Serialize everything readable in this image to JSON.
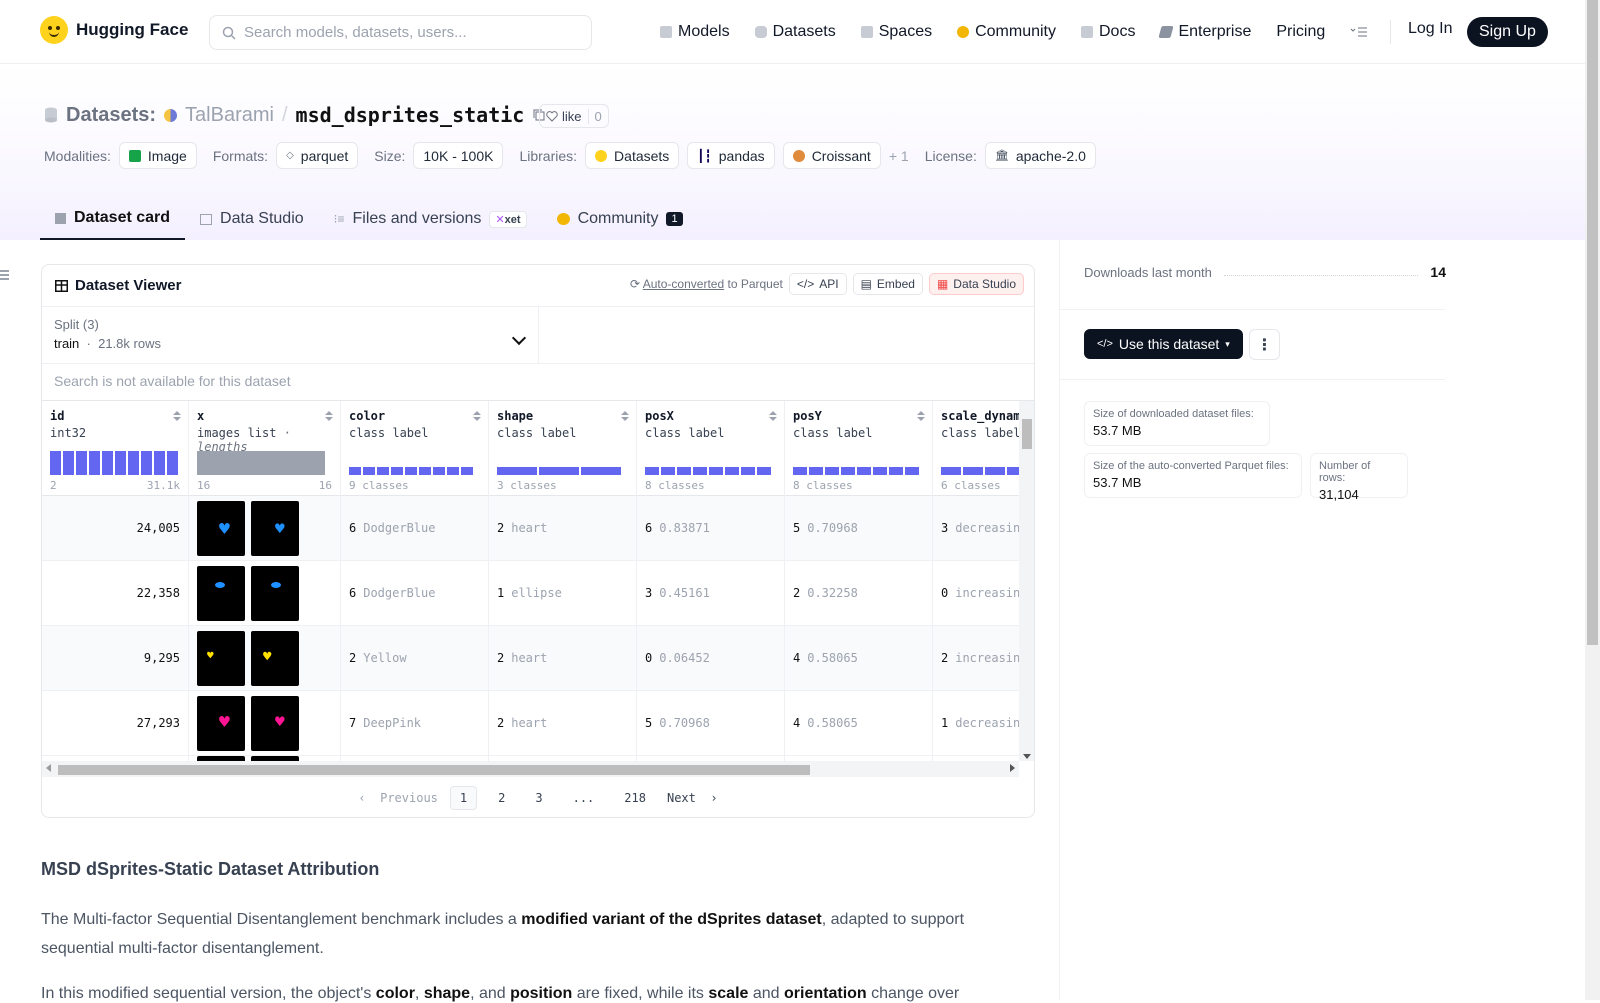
{
  "nav": {
    "brand": "Hugging Face",
    "search_placeholder": "Search models, datasets, users...",
    "items": [
      {
        "label": "Models",
        "icon": "cube-icon",
        "color": "#9ca3af"
      },
      {
        "label": "Datasets",
        "icon": "database-icon",
        "color": "#9ca3af"
      },
      {
        "label": "Spaces",
        "icon": "grid-icon",
        "color": "#9ca3af"
      },
      {
        "label": "Community",
        "icon": "hugging-icon",
        "color": "#f2b705"
      },
      {
        "label": "Docs",
        "icon": "book-icon",
        "color": "#9ca3af"
      },
      {
        "label": "Enterprise",
        "icon": "enterprise-icon",
        "color": "#6b7280"
      },
      {
        "label": "Pricing",
        "icon": "",
        "color": ""
      }
    ],
    "login": "Log In",
    "signup": "Sign Up"
  },
  "header": {
    "section": "Datasets:",
    "user": "TalBarami",
    "repo": "msd_dsprites_static",
    "like_label": "like",
    "like_count": "0",
    "modalities_k": "Modalities:",
    "modality": "Image",
    "formats_k": "Formats:",
    "format": "parquet",
    "size_k": "Size:",
    "size": "10K - 100K",
    "libraries_k": "Libraries:",
    "libraries": [
      "Datasets",
      "pandas",
      "Croissant"
    ],
    "lib_more": "+ 1",
    "license_k": "License:",
    "license": "apache-2.0"
  },
  "tabs": [
    {
      "label": "Dataset card",
      "active": true
    },
    {
      "label": "Data Studio"
    },
    {
      "label": "Files and versions",
      "badge": "xet"
    },
    {
      "label": "Community",
      "badge": "1"
    }
  ],
  "viewer": {
    "title": "Dataset Viewer",
    "autoconv": "Auto-converted",
    "autoconv_suffix": "to Parquet",
    "api": "API",
    "embed": "Embed",
    "studio": "Data Studio",
    "split_label": "Split (3)",
    "split_value": "train",
    "split_rows": "21.8k rows",
    "search_note": "Search is not available for this dataset",
    "columns": [
      {
        "name": "id",
        "type": "int32",
        "range_min": "2",
        "range_max": "31.1k"
      },
      {
        "name": "x",
        "type": "images list",
        "type_extra": "· lengths",
        "range_min": "16",
        "range_max": "16"
      },
      {
        "name": "color",
        "type": "class label",
        "classes": "9 classes"
      },
      {
        "name": "shape",
        "type": "class label",
        "classes": "3 classes"
      },
      {
        "name": "posX",
        "type": "class label",
        "classes": "8 classes"
      },
      {
        "name": "posY",
        "type": "class label",
        "classes": "8 classes"
      },
      {
        "name": "scale_dynam",
        "type": "class label",
        "classes": "6 classes"
      }
    ],
    "rows": [
      {
        "id": "24,005",
        "color_n": "6",
        "color": "DodgerBlue",
        "color_hex": "#1e90ff",
        "shape_n": "2",
        "shape": "heart",
        "posx_n": "6",
        "posx": "0.83871",
        "posy_n": "5",
        "posy": "0.70968",
        "scale_n": "3",
        "scale": "decreasin"
      },
      {
        "id": "22,358",
        "color_n": "6",
        "color": "DodgerBlue",
        "color_hex": "#1e90ff",
        "shape_n": "1",
        "shape": "ellipse",
        "posx_n": "3",
        "posx": "0.45161",
        "posy_n": "2",
        "posy": "0.32258",
        "scale_n": "0",
        "scale": "increasin"
      },
      {
        "id": "9,295",
        "color_n": "2",
        "color": "Yellow",
        "color_hex": "#ffe000",
        "shape_n": "2",
        "shape": "heart",
        "posx_n": "0",
        "posx": "0.06452",
        "posy_n": "4",
        "posy": "0.58065",
        "scale_n": "2",
        "scale": "increasin"
      },
      {
        "id": "27,293",
        "color_n": "7",
        "color": "DeepPink",
        "color_hex": "#ff1493",
        "shape_n": "2",
        "shape": "heart",
        "posx_n": "5",
        "posx": "0.70968",
        "posy_n": "4",
        "posy": "0.58065",
        "scale_n": "1",
        "scale": "decreasin"
      }
    ],
    "pager": {
      "prev": "Previous",
      "pages": [
        "1",
        "2",
        "3",
        "...",
        "218"
      ],
      "next": "Next"
    }
  },
  "sidebar": {
    "downloads_label": "Downloads last month",
    "downloads": "14",
    "use_dataset": "Use this dataset",
    "stats": [
      {
        "k": "Size of downloaded dataset files:",
        "v": "53.7 MB"
      },
      {
        "k": "Size of the auto-converted Parquet files:",
        "v": "53.7 MB"
      },
      {
        "k": "Number of rows:",
        "v": "31,104"
      }
    ]
  },
  "readme": {
    "heading": "MSD dSprites-Static Dataset Attribution",
    "p1_a": "The Multi-factor Sequential Disentanglement benchmark includes a ",
    "p1_b": "modified variant of the dSprites dataset",
    "p1_c": ", adapted to support sequential multi-factor disentanglement.",
    "p2_a": "In this modified sequential version, the object's ",
    "p2_b": "color",
    "p2_c": ", ",
    "p2_d": "shape",
    "p2_e": ", and ",
    "p2_f": "position",
    "p2_g": " are fixed, while its ",
    "p2_h": "scale",
    "p2_i": " and ",
    "p2_j": "orientation",
    "p2_k": " change over"
  }
}
